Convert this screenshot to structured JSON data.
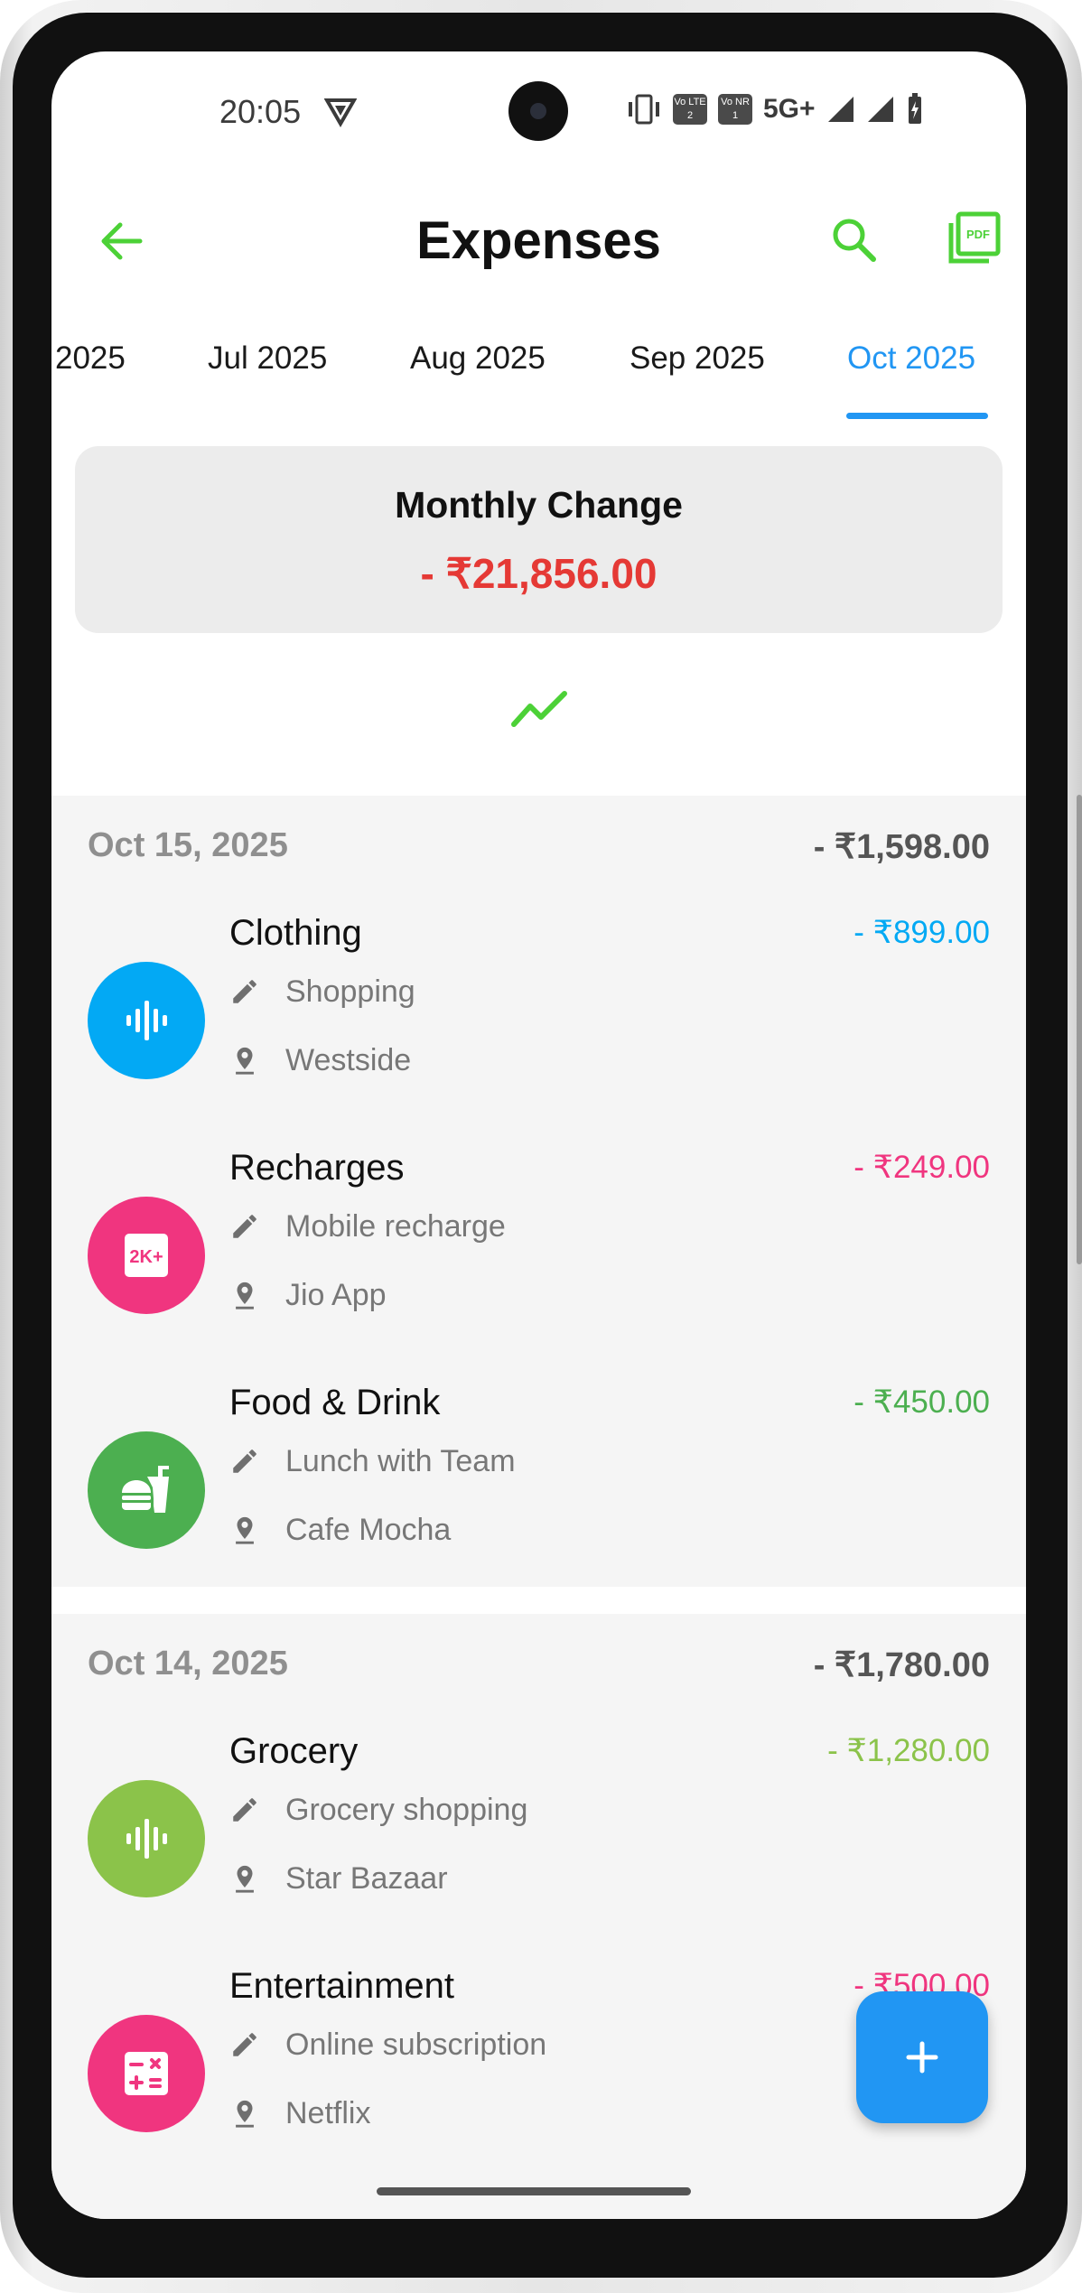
{
  "status_bar": {
    "time": "20:05",
    "sim1": "Vo LTE 2",
    "sim2": "Vo NR 1",
    "network": "5G+"
  },
  "header": {
    "title": "Expenses"
  },
  "tabs": [
    "2025",
    "Jul 2025",
    "Aug 2025",
    "Sep 2025",
    "Oct 2025"
  ],
  "active_tab": "Oct 2025",
  "summary": {
    "title": "Monthly Change",
    "value": "- ₹21,856.00"
  },
  "groups": [
    {
      "date": "Oct 15, 2025",
      "total": "- ₹1,598.00",
      "items": [
        {
          "title": "Clothing",
          "amount": "- ₹899.00",
          "note": "Shopping",
          "place": "Westside",
          "color": "#03a9f4",
          "icon": "audio-wave-icon"
        },
        {
          "title": "Recharges",
          "amount": "- ₹249.00",
          "note": "Mobile recharge",
          "place": "Jio App",
          "color": "#f0357f",
          "icon": "2k-plus-icon"
        },
        {
          "title": "Food & Drink",
          "amount": "- ₹450.00",
          "note": "Lunch with Team",
          "place": "Cafe Mocha",
          "color": "#4caf50",
          "icon": "fastfood-icon"
        }
      ]
    },
    {
      "date": "Oct 14, 2025",
      "total": "- ₹1,780.00",
      "items": [
        {
          "title": "Grocery",
          "amount": "- ₹1,280.00",
          "note": "Grocery shopping",
          "place": "Star Bazaar",
          "color": "#8bc34a",
          "icon": "audio-wave-icon"
        },
        {
          "title": "Entertainment",
          "amount": "- ₹500.00",
          "note": "Online subscription",
          "place": "Netflix",
          "color": "#f0357f",
          "icon": "calculate-icon"
        }
      ]
    }
  ],
  "colors": {
    "accent": "#4cd137",
    "primary": "#2196f3",
    "negative": "#e53935"
  }
}
